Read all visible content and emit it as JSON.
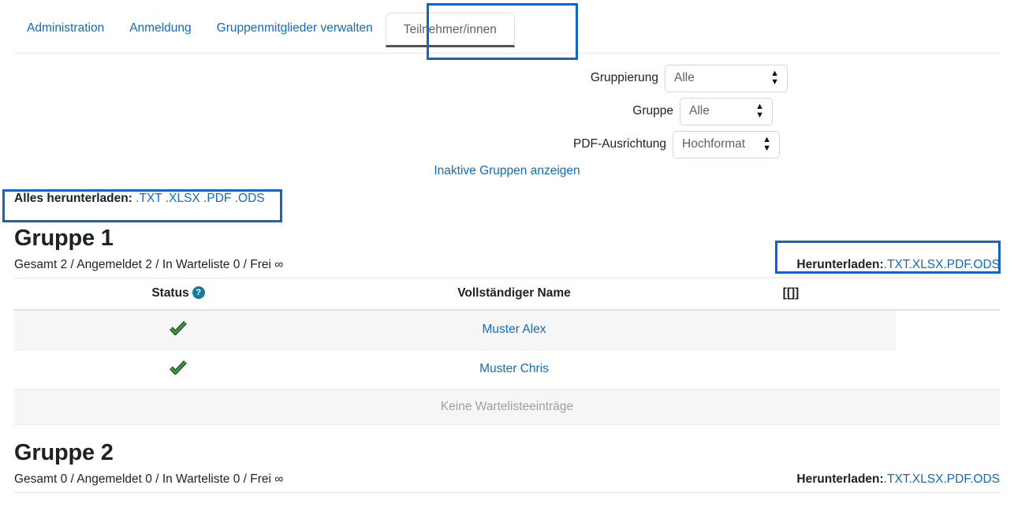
{
  "colors": {
    "link": "#0f6cbf",
    "highlight_box": "#1565c0",
    "text": "#1d2125",
    "help_icon_bg": "#17799e",
    "check_green": "#2ea02e",
    "stripe_bg": "#f6f6f6",
    "muted": "#9aa0a6"
  },
  "tabs": [
    {
      "label": "Administration",
      "active": false
    },
    {
      "label": "Anmeldung",
      "active": false
    },
    {
      "label": "Gruppenmitglieder verwalten",
      "active": false
    },
    {
      "label": "Teilnehmer/innen",
      "active": true
    }
  ],
  "filters": [
    {
      "label": "Gruppierung",
      "value": "Alle",
      "name": "gruppierung"
    },
    {
      "label": "Gruppe",
      "value": "Alle",
      "name": "gruppe"
    },
    {
      "label": "PDF-Ausrichtung",
      "value": "Hochformat",
      "name": "pdf-ausrichtung"
    }
  ],
  "inactive_groups_link": "Inaktive Gruppen anzeigen",
  "download_all": {
    "label": "Alles herunterladen:",
    "formats": [
      ".TXT",
      ".XLSX",
      ".PDF",
      ".ODS"
    ]
  },
  "download_group": {
    "label": "Herunterladen:",
    "formats": [
      ".TXT",
      ".XLSX",
      ".PDF",
      ".ODS"
    ]
  },
  "table_headers": {
    "status": "Status",
    "help_icon": "?",
    "full_name": "Vollständiger Name",
    "extra": "[[]]"
  },
  "empty_waitlist_text": "Keine Warteliste­einträge",
  "groups": [
    {
      "title": "Gruppe 1",
      "meta": "Gesamt 2 / Angemeldet 2 / In Warteliste 0 / Frei ∞",
      "rows": [
        {
          "status_icon": "check-green",
          "name": "Muster Alex"
        },
        {
          "status_icon": "check-green",
          "name": "Muster Chris"
        }
      ],
      "waitlist_empty": "Keine Warteliste­einträge"
    },
    {
      "title": "Gruppe 2",
      "meta": "Gesamt 0 / Angemeldet 0 / In Warteliste 0 / Frei ∞",
      "rows": [],
      "waitlist_empty": ""
    }
  ]
}
